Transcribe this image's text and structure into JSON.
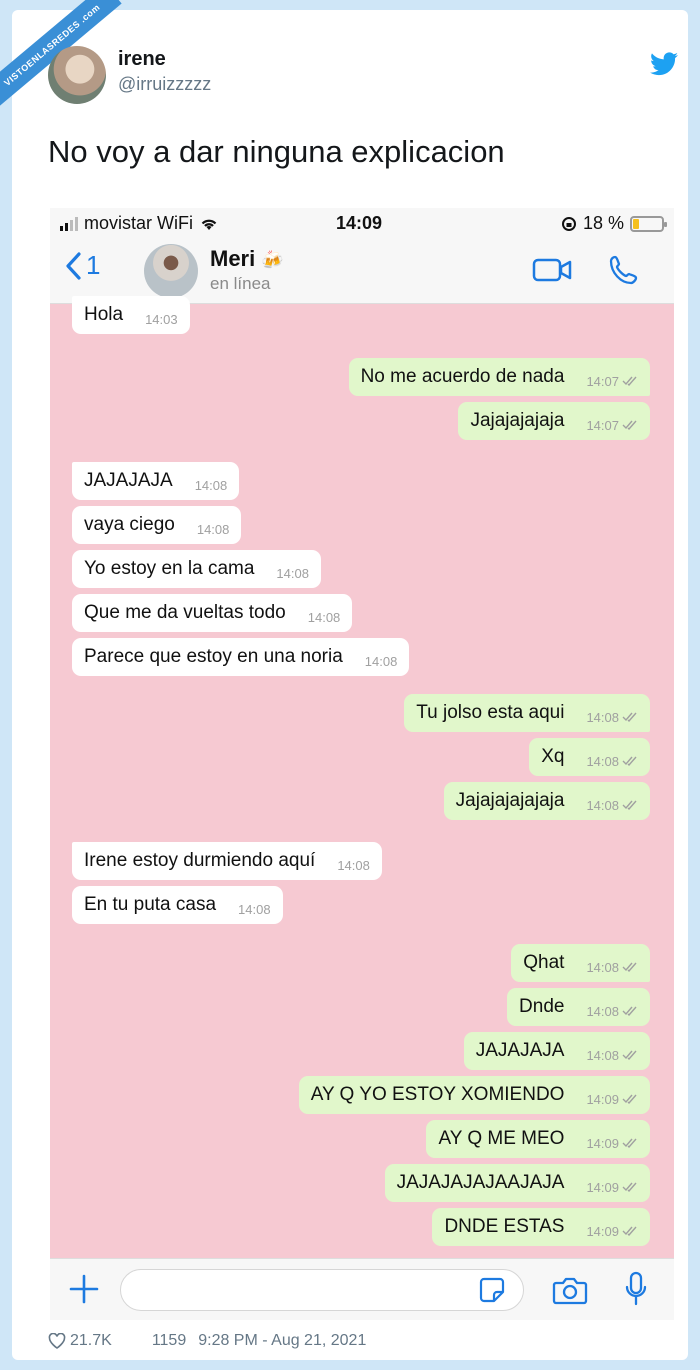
{
  "watermark": "VISTOENLASREDES .com",
  "tweet": {
    "name": "irene",
    "handle": "@irruizzzzz",
    "text": "No voy a dar ninguna explicacion",
    "likes": "21.7K",
    "count": "1159",
    "datetime": "9:28 PM - Aug 21, 2021",
    "accent_color": "#1da1f2"
  },
  "phone": {
    "carrier": "movistar WiFi",
    "time": "14:09",
    "battery": "18 %",
    "battery_level": 0.18
  },
  "chat": {
    "back_count": "1",
    "contact_name": "Meri",
    "contact_emoji": "🍻",
    "contact_status": "en línea",
    "background_color": "#f6c9d2",
    "incoming_color": "#ffffff",
    "outgoing_color": "#e1f7cb",
    "messages": [
      {
        "text": "Hola",
        "time": "14:03",
        "dir": "in"
      },
      {
        "text": "No me acuerdo de nada",
        "time": "14:07",
        "dir": "out"
      },
      {
        "text": "Jajajajajaja",
        "time": "14:07",
        "dir": "out"
      },
      {
        "text": "JAJAJAJA",
        "time": "14:08",
        "dir": "in"
      },
      {
        "text": "vaya ciego",
        "time": "14:08",
        "dir": "in"
      },
      {
        "text": "Yo estoy en la cama",
        "time": "14:08",
        "dir": "in"
      },
      {
        "text": "Que me da vueltas todo",
        "time": "14:08",
        "dir": "in"
      },
      {
        "text": "Parece que estoy en una noria",
        "time": "14:08",
        "dir": "in"
      },
      {
        "text": "Tu jolso esta aqui",
        "time": "14:08",
        "dir": "out"
      },
      {
        "text": "Xq",
        "time": "14:08",
        "dir": "out"
      },
      {
        "text": "Jajajajajajaja",
        "time": "14:08",
        "dir": "out"
      },
      {
        "text": "Irene estoy durmiendo aquí",
        "time": "14:08",
        "dir": "in"
      },
      {
        "text": "En tu puta casa",
        "time": "14:08",
        "dir": "in"
      },
      {
        "text": "Qhat",
        "time": "14:08",
        "dir": "out"
      },
      {
        "text": "Dnde",
        "time": "14:08",
        "dir": "out"
      },
      {
        "text": "JAJAJAJA",
        "time": "14:08",
        "dir": "out"
      },
      {
        "text": "AY Q YO ESTOY XOMIENDO",
        "time": "14:09",
        "dir": "out"
      },
      {
        "text": "AY Q ME MEO",
        "time": "14:09",
        "dir": "out"
      },
      {
        "text": "JAJAJAJAJAAJAJA",
        "time": "14:09",
        "dir": "out"
      },
      {
        "text": "DNDE ESTAS",
        "time": "14:09",
        "dir": "out"
      }
    ]
  }
}
